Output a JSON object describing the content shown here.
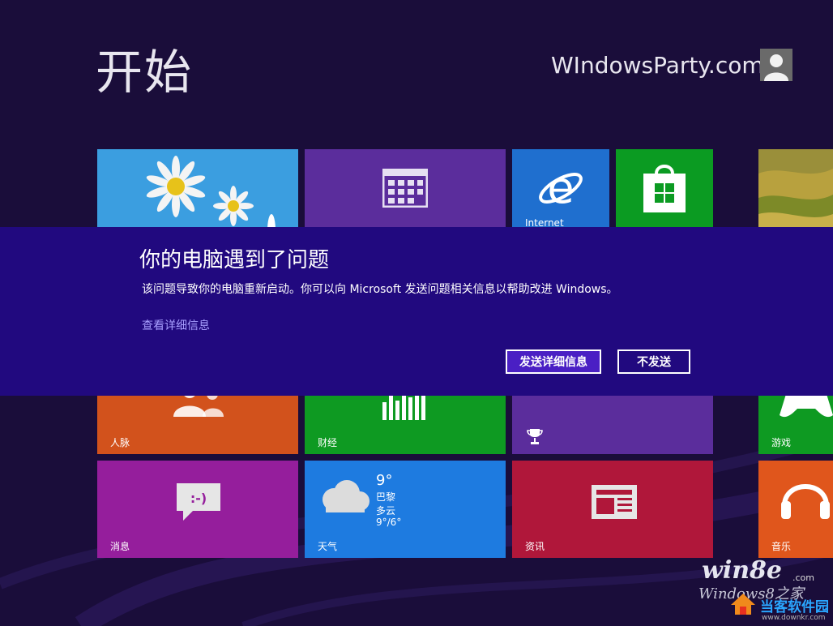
{
  "start": {
    "title": "开始"
  },
  "user": {
    "name": "WIndowsParty.com",
    "avatar_icon": "user-silhouette-icon"
  },
  "tiles": {
    "photos": {
      "icon": "daisy-photo-icon"
    },
    "calendar": {
      "icon": "calendar-icon"
    },
    "ie": {
      "label": "Internet",
      "icon": "internet-explorer-icon"
    },
    "store": {
      "icon": "store-bag-icon"
    },
    "landscape": {
      "icon": "landscape-photo-icon"
    },
    "people": {
      "label": "人脉",
      "icon": "people-icon"
    },
    "finance": {
      "label": "财经",
      "icon": "finance-chart-icon"
    },
    "games": {
      "icon": "trophy-icon"
    },
    "xbox": {
      "label": "游戏",
      "icon": "gamepad-icon"
    },
    "messaging": {
      "label": "消息",
      "icon": "chat-bubble-icon"
    },
    "weather": {
      "label": "天气",
      "icon": "cloud-icon",
      "temp": "9°",
      "city": "巴黎",
      "condition": "多云",
      "range": "9°/6°"
    },
    "news": {
      "label": "资讯",
      "icon": "newspaper-icon"
    },
    "music": {
      "label": "音乐",
      "icon": "headphones-icon"
    }
  },
  "dialog": {
    "title": "你的电脑遇到了问题",
    "message": "该问题导致你的电脑重新启动。你可以向 Microsoft 发送问题相关信息以帮助改进 Windows。",
    "details_link": "查看详细信息",
    "send_button": "发送详细信息",
    "dont_send_button": "不发送"
  },
  "watermark": {
    "brand": "win8e",
    "brand_suffix": ".com",
    "subtitle": "Windows8之家",
    "site": "当客软件园",
    "url": "www.downkr.com"
  },
  "colors": {
    "background": "#1a0d3a",
    "dialog": "#21097f",
    "send_button": "#4a1fc4",
    "link": "#a89fff"
  }
}
